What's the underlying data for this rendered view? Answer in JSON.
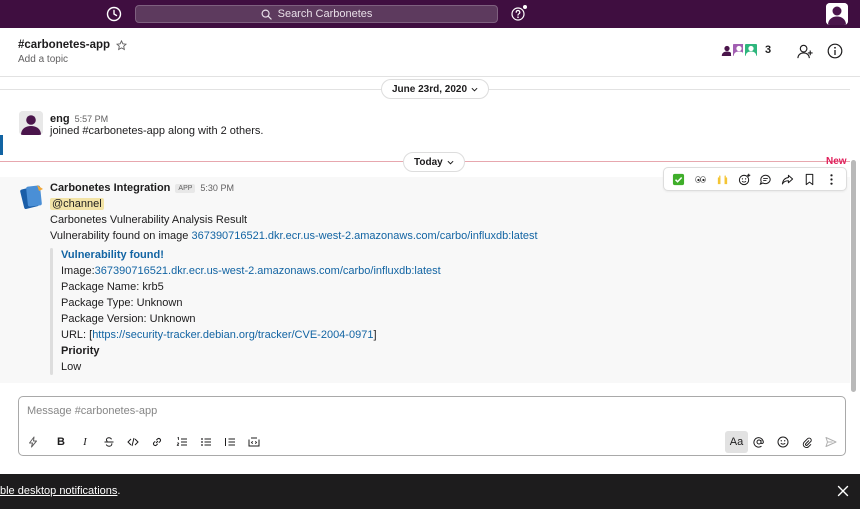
{
  "colors": {
    "sidebar_aubergine": "#3f0e40",
    "link_blue": "#1264a3",
    "new_red": "#e01e5a",
    "mention_bg": "#f2e3a6",
    "banner_bg": "#1d1c1d"
  },
  "topbar": {
    "search_placeholder": "Search Carbonetes",
    "icons": [
      "history-icon",
      "search-icon",
      "help-icon",
      "user-avatar"
    ]
  },
  "header": {
    "channel_name": "#carbonetes-app",
    "topic": "Add a topic",
    "member_count": "3",
    "icons": [
      "star-icon",
      "add-member-icon",
      "info-icon"
    ]
  },
  "dividers": {
    "date_label": "June 23rd, 2020",
    "today_label": "Today",
    "new_label": "New"
  },
  "messages": [
    {
      "author": "eng",
      "time": "5:57 PM",
      "text": "joined #carbonetes-app along with 2 others."
    },
    {
      "author": "Carbonetes Integration",
      "badge": "APP",
      "time": "5:30 PM",
      "mention": "@channel",
      "line1": "Carbonetes Vulnerability Analysis Result",
      "line2_prefix": "Vulnerability found on image ",
      "image_link": "367390716521.dkr.ecr.us-west-2.amazonaws.com/carbo/influxdb:latest",
      "attachment": {
        "title": "Vulnerability found!",
        "image_label": "Image:",
        "image_link": "367390716521.dkr.ecr.us-west-2.amazonaws.com/carbo/influxdb:latest",
        "package_name": "Package Name: krb5",
        "package_type": "Package Type: Unknown",
        "package_version": "Package Version: Unknown",
        "url_prefix": "URL: [",
        "url_link": "https://security-tracker.debian.org/tracker/CVE-2004-0971",
        "url_suffix": "]",
        "priority_label": "Priority",
        "priority_value": "Low"
      }
    }
  ],
  "message_actions": [
    "white-check-mark-emoji",
    "eyes-emoji",
    "raised-hands-emoji",
    "add-reaction-icon",
    "reply-thread-icon",
    "share-icon",
    "bookmark-icon",
    "more-actions-icon"
  ],
  "composer": {
    "placeholder": "Message #carbonetes-app",
    "aa_label": "Aa",
    "toolbar": [
      "shortcuts-icon",
      "bold-icon",
      "italic-icon",
      "strikethrough-icon",
      "code-icon",
      "link-icon",
      "ordered-list-icon",
      "bulleted-list-icon",
      "blockquote-icon",
      "code-block-icon",
      "format-toggle",
      "mention-icon",
      "emoji-icon",
      "attach-icon",
      "send-icon"
    ]
  },
  "banner": {
    "text": "ble desktop notifications",
    "suffix": "."
  }
}
